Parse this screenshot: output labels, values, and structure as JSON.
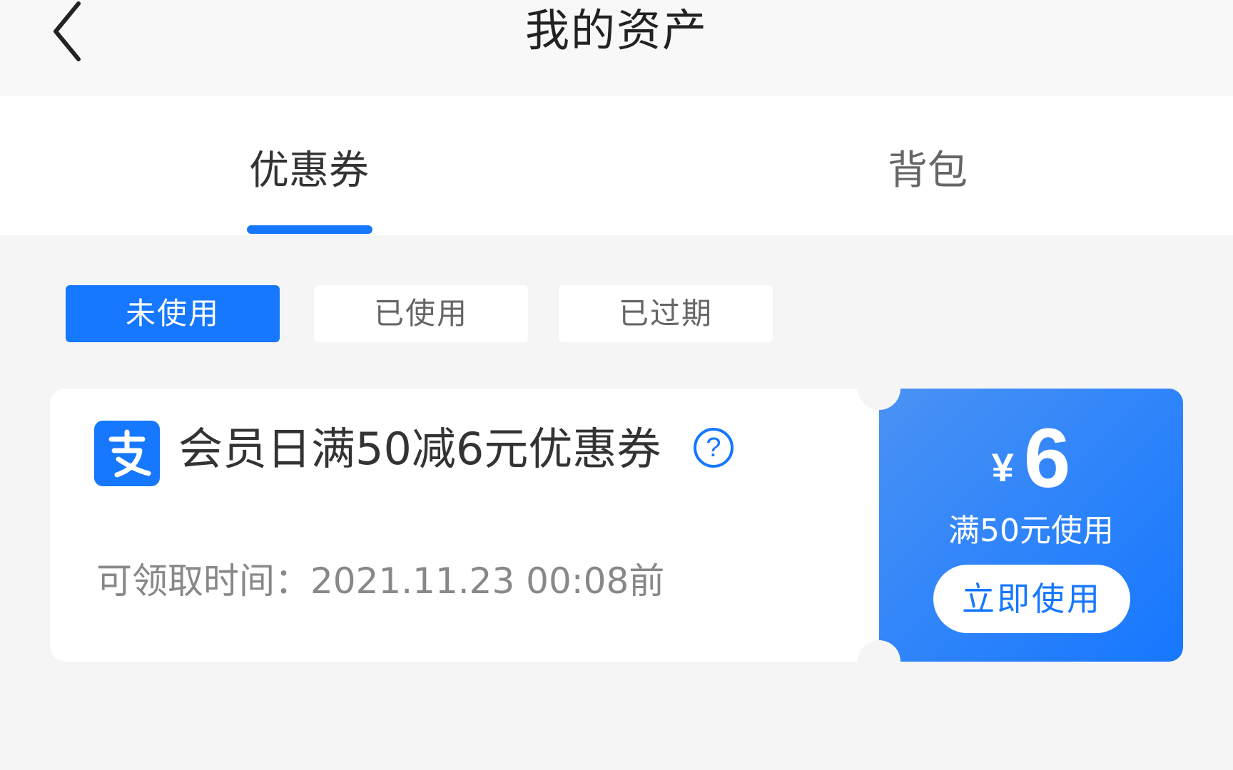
{
  "header": {
    "title": "我的资产",
    "back_icon": "chevron-left-icon"
  },
  "tabs": [
    {
      "label": "优惠券",
      "active": true
    },
    {
      "label": "背包",
      "active": false
    }
  ],
  "filters": [
    {
      "label": "未使用",
      "active": true
    },
    {
      "label": "已使用",
      "active": false
    },
    {
      "label": "已过期",
      "active": false
    }
  ],
  "coupon": {
    "logo_icon": "alipay-logo-icon",
    "title": "会员日满50减6元优惠券",
    "help_icon": "?",
    "claim_time": "可领取时间：2021.11.23 00:08前",
    "currency": "¥",
    "amount": "6",
    "threshold": "满50元使用",
    "action_label": "立即使用"
  },
  "colors": {
    "accent": "#1677ff",
    "background": "#f5f5f5",
    "card": "#ffffff"
  }
}
